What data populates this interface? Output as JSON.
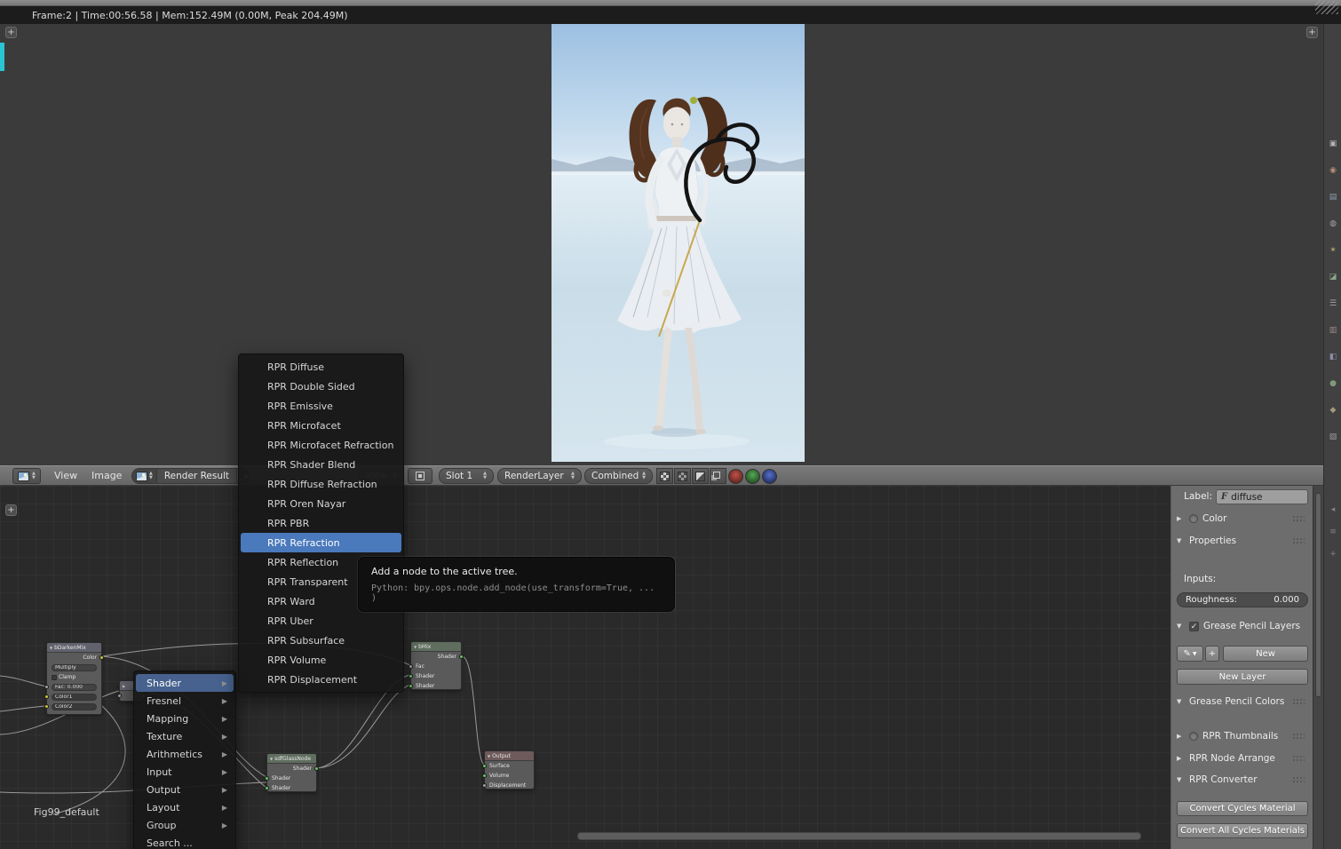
{
  "topbar": {
    "stats": "Frame:2 | Time:00:56.58 | Mem:152.49M (0.00M, Peak 204.49M)"
  },
  "image_header": {
    "view_menu": "View",
    "image_menu": "Image",
    "datablock": "Render Result",
    "view_dropdown": "View",
    "slot": "Slot 1",
    "layer": "RenderLayer",
    "pass": "Combined"
  },
  "add_menu": {
    "items": [
      {
        "label": "Shader",
        "submenu": true,
        "highlighted": true
      },
      {
        "label": "Fresnel",
        "submenu": true
      },
      {
        "label": "Mapping",
        "submenu": true
      },
      {
        "label": "Texture",
        "submenu": true
      },
      {
        "label": "Arithmetics",
        "submenu": true
      },
      {
        "label": "Input",
        "submenu": true
      },
      {
        "label": "Output",
        "submenu": true
      },
      {
        "label": "Layout",
        "submenu": true
      },
      {
        "label": "Group",
        "submenu": true
      },
      {
        "label": "Search ...",
        "submenu": false
      }
    ]
  },
  "shader_submenu": {
    "items": [
      {
        "label": "RPR Diffuse"
      },
      {
        "label": "RPR Double Sided"
      },
      {
        "label": "RPR Emissive"
      },
      {
        "label": "RPR Microfacet"
      },
      {
        "label": "RPR Microfacet Refraction"
      },
      {
        "label": "RPR Shader Blend"
      },
      {
        "label": "RPR Diffuse Refraction"
      },
      {
        "label": "RPR Oren Nayar"
      },
      {
        "label": "RPR PBR"
      },
      {
        "label": "RPR Refraction",
        "highlighted": true
      },
      {
        "label": "RPR Reflection"
      },
      {
        "label": "RPR Transparent"
      },
      {
        "label": "RPR Ward"
      },
      {
        "label": "RPR Uber"
      },
      {
        "label": "RPR Subsurface"
      },
      {
        "label": "RPR Volume"
      },
      {
        "label": "RPR Displacement"
      }
    ]
  },
  "tooltip": {
    "title": "Add a node to the active tree.",
    "python": "Python: bpy.ops.node.add_node(use_transform=True, ... )"
  },
  "side_panel": {
    "label_caption": "Label:",
    "label_value": "diffuse",
    "color": "Color",
    "properties": "Properties",
    "inputs": "Inputs:",
    "roughness_label": "Roughness:",
    "roughness_value": "0.000",
    "gp_layers": "Grease Pencil Layers",
    "new": "New",
    "new_layer": "New Layer",
    "gp_colors": "Grease Pencil Colors",
    "rpr_thumbnails": "RPR Thumbnails",
    "rpr_node_arrange": "RPR Node Arrange",
    "rpr_converter": "RPR Converter",
    "convert_cycles": "Convert Cycles Material",
    "convert_all": "Convert All Cycles Materials"
  },
  "node_editor": {
    "tree_label": "Fig99_default",
    "mix_node": {
      "title": "bDarkenMix",
      "out": "Color",
      "blend": "Multiply",
      "clamp": "Clamp",
      "fac": "Fac: 0.000",
      "color1": "Color1",
      "color2": "Color2"
    },
    "glass_node": {
      "title": "sdfGlassNode",
      "out": "Shader",
      "in1": "Shader",
      "in2": "Shader"
    },
    "mix_shader_node": {
      "title": "bMix",
      "out": "Shader",
      "in1": "Fac",
      "in2": "Shader",
      "in3": "Shader"
    },
    "output_node": {
      "title": "Output",
      "in1": "Surface",
      "in2": "Volume",
      "in3": "Displacement"
    }
  },
  "colors": {
    "menu_highlight": "#4a79bc",
    "accent_cyan": "#2bc4d4"
  }
}
